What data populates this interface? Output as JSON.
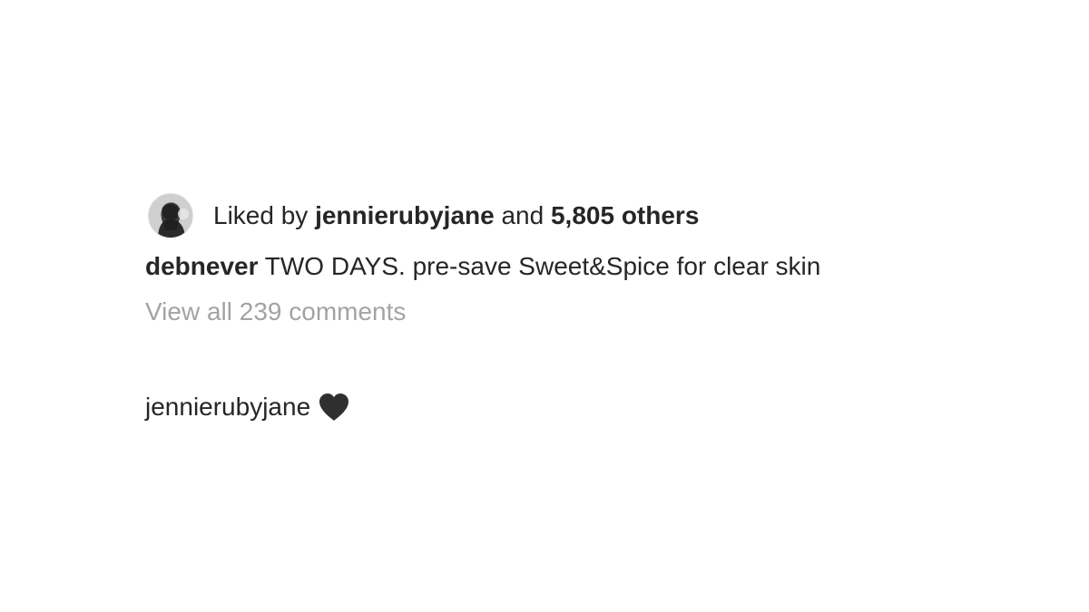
{
  "likes": {
    "prefix": "Liked by ",
    "liker_username": "jennierubyjane",
    "connector": " and ",
    "others_count": "5,805 others"
  },
  "caption": {
    "username": "debnever",
    "text": " TWO DAYS. pre-save Sweet&Spice for clear skin"
  },
  "comments": {
    "view_all_label": "View all 239 comments",
    "items": [
      {
        "username": "jennierubyjane",
        "text": "",
        "emoji_icon": "black-heart-icon"
      }
    ]
  },
  "colors": {
    "text_primary": "#262626",
    "text_secondary": "#a3a3a3",
    "background": "#ffffff",
    "heart": "#2f2f2f"
  }
}
